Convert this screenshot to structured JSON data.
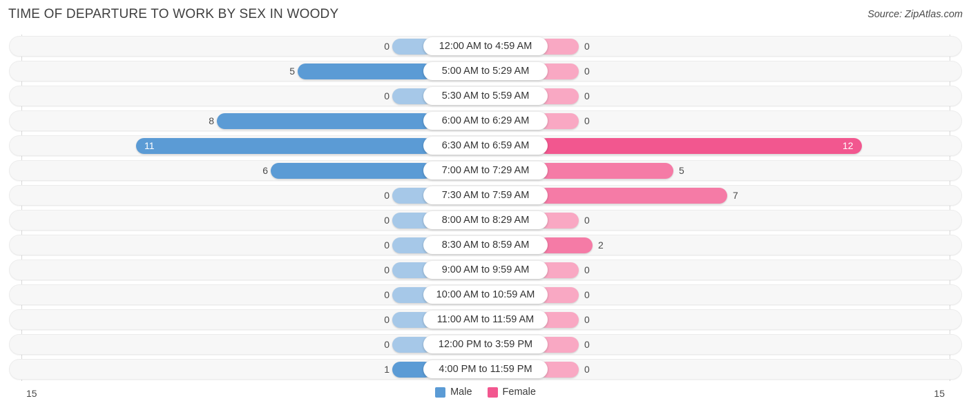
{
  "header": {
    "title": "TIME OF DEPARTURE TO WORK BY SEX IN WOODY",
    "source": "Source: ZipAtlas.com"
  },
  "legend": {
    "male_label": "Male",
    "female_label": "Female",
    "male_color": "#5b9bd5",
    "female_color": "#f2578f"
  },
  "axis": {
    "left_max": "15",
    "right_max": "15"
  },
  "chart_data": {
    "type": "bar",
    "title": "TIME OF DEPARTURE TO WORK BY SEX IN WOODY",
    "orientation": "horizontal-diverging",
    "xlabel": "",
    "ylabel": "",
    "xlim": [
      15,
      15
    ],
    "grid": false,
    "legend_position": "bottom-center",
    "categories": [
      "12:00 AM to 4:59 AM",
      "5:00 AM to 5:29 AM",
      "5:30 AM to 5:59 AM",
      "6:00 AM to 6:29 AM",
      "6:30 AM to 6:59 AM",
      "7:00 AM to 7:29 AM",
      "7:30 AM to 7:59 AM",
      "8:00 AM to 8:29 AM",
      "8:30 AM to 8:59 AM",
      "9:00 AM to 9:59 AM",
      "10:00 AM to 10:59 AM",
      "11:00 AM to 11:59 AM",
      "12:00 PM to 3:59 PM",
      "4:00 PM to 11:59 PM"
    ],
    "series": [
      {
        "name": "Male",
        "color": "#5b9bd5",
        "values": [
          0,
          5,
          0,
          8,
          11,
          6,
          0,
          0,
          0,
          0,
          0,
          0,
          0,
          1
        ]
      },
      {
        "name": "Female",
        "color": "#f2578f",
        "values": [
          0,
          0,
          0,
          0,
          12,
          5,
          7,
          0,
          2,
          0,
          0,
          0,
          0,
          0
        ]
      }
    ]
  },
  "rows": [
    {
      "category": "12:00 AM to 4:59 AM",
      "male": "0",
      "female": "0"
    },
    {
      "category": "5:00 AM to 5:29 AM",
      "male": "5",
      "female": "0"
    },
    {
      "category": "5:30 AM to 5:59 AM",
      "male": "0",
      "female": "0"
    },
    {
      "category": "6:00 AM to 6:29 AM",
      "male": "8",
      "female": "0"
    },
    {
      "category": "6:30 AM to 6:59 AM",
      "male": "11",
      "female": "12"
    },
    {
      "category": "7:00 AM to 7:29 AM",
      "male": "6",
      "female": "5"
    },
    {
      "category": "7:30 AM to 7:59 AM",
      "male": "0",
      "female": "7"
    },
    {
      "category": "8:00 AM to 8:29 AM",
      "male": "0",
      "female": "0"
    },
    {
      "category": "8:30 AM to 8:59 AM",
      "male": "0",
      "female": "2"
    },
    {
      "category": "9:00 AM to 9:59 AM",
      "male": "0",
      "female": "0"
    },
    {
      "category": "10:00 AM to 10:59 AM",
      "male": "0",
      "female": "0"
    },
    {
      "category": "11:00 AM to 11:59 AM",
      "male": "0",
      "female": "0"
    },
    {
      "category": "12:00 PM to 3:59 PM",
      "male": "0",
      "female": "0"
    },
    {
      "category": "4:00 PM to 11:59 PM",
      "male": "1",
      "female": "0"
    }
  ]
}
